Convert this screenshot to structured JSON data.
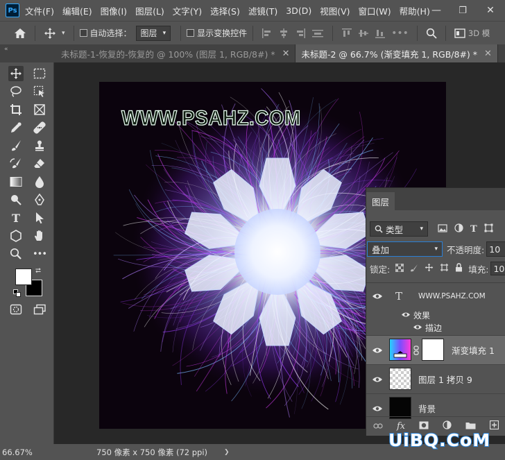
{
  "app": {
    "logo": "Ps",
    "menu": [
      "文件(F)",
      "编辑(E)",
      "图像(I)",
      "图层(L)",
      "文字(Y)",
      "选择(S)",
      "滤镜(T)",
      "3D(D)",
      "视图(V)",
      "窗口(W)",
      "帮助(H)"
    ],
    "window_controls": {
      "minimize": "—",
      "restore": "❐",
      "close": "✕"
    }
  },
  "options": {
    "auto_select_label": "自动选择：",
    "auto_select_target": "图层",
    "show_transform_label": "显示变换控件",
    "mode_3d": "3D 模"
  },
  "tabs": [
    {
      "label": "未标题-1-恢复的-恢复的 @ 100% (图层 1, RGB/8#) *",
      "active": false
    },
    {
      "label": "未标题-2 @ 66.7% (渐变填充 1, RGB/8#) *",
      "active": true
    }
  ],
  "canvas": {
    "title_text": "WWW.PSAHZ.COM",
    "background": "#0b030d"
  },
  "layers_panel": {
    "tab": "图层",
    "filter": "类型",
    "blend_mode": "叠加",
    "opacity_label": "不透明度:",
    "opacity_value": "10",
    "lock_label": "锁定:",
    "fill_label": "填充:",
    "fill_value": "10",
    "layers": [
      {
        "name": "WWW.PSAHZ.COM",
        "kind": "text",
        "visible": true,
        "selected": false
      },
      {
        "name": "效果",
        "kind": "effects",
        "visible": true
      },
      {
        "name": "描边",
        "kind": "effect",
        "visible": true
      },
      {
        "name": "渐变填充 1",
        "kind": "gradient",
        "visible": true,
        "selected": true
      },
      {
        "name": "图层 1 拷贝 9",
        "kind": "pixel",
        "visible": true,
        "selected": false
      },
      {
        "name": "背景",
        "kind": "background",
        "visible": true,
        "selected": false
      }
    ],
    "footer_icons": [
      "link-icon",
      "fx-icon",
      "mask-icon",
      "adjustment-icon",
      "folder-icon",
      "new-layer-icon"
    ],
    "fx_label": "fx"
  },
  "status": {
    "zoom": "66.67%",
    "doc_info": "750 像素 x 750 像素 (72 ppi)",
    "arrow": "❯"
  },
  "watermark": "UiBQ.CoM",
  "colors": {
    "accent_ps": "#31a8ff",
    "flower_purple": "#9b3dff",
    "flower_pink": "#d23cf0",
    "flower_blue": "#7ab8ff"
  }
}
